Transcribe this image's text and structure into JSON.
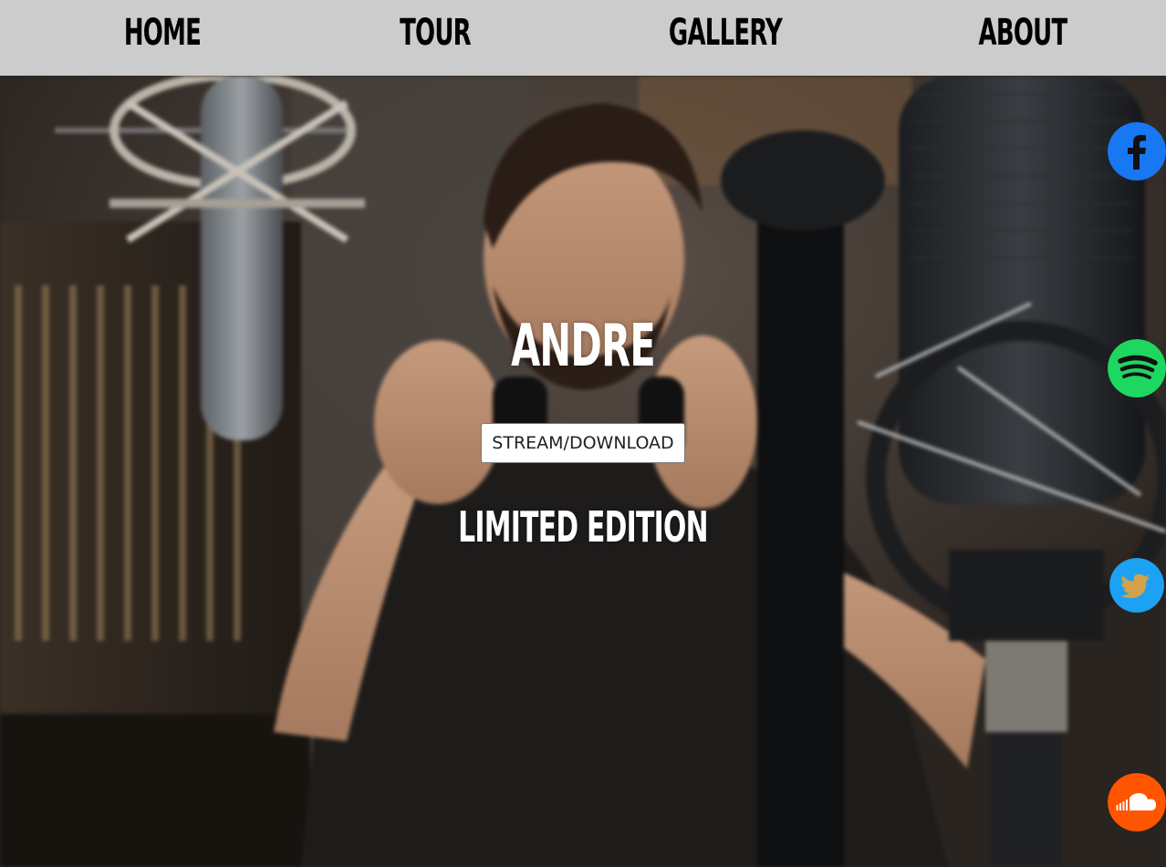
{
  "nav": {
    "items": [
      {
        "label": "HOME"
      },
      {
        "label": "TOUR"
      },
      {
        "label": "GALLERY"
      },
      {
        "label": "ABOUT"
      }
    ]
  },
  "hero": {
    "title": "ANDRE",
    "cta_label": "STREAM/DOWNLOAD",
    "subtitle": "LIMITED EDITION",
    "background_image": "recording-studio-photo"
  },
  "social": [
    {
      "name": "facebook",
      "icon": "facebook-icon",
      "color": "#1877f2"
    },
    {
      "name": "spotify",
      "icon": "spotify-icon",
      "color": "#1ed760"
    },
    {
      "name": "twitter",
      "icon": "twitter-icon",
      "color": "#1da1f2"
    },
    {
      "name": "soundcloud",
      "icon": "soundcloud-icon",
      "color": "#ff5500"
    }
  ],
  "colors": {
    "nav_background": "#cccccc",
    "nav_text": "#000000",
    "hero_text": "#ffffff",
    "button_background": "#ffffff"
  }
}
